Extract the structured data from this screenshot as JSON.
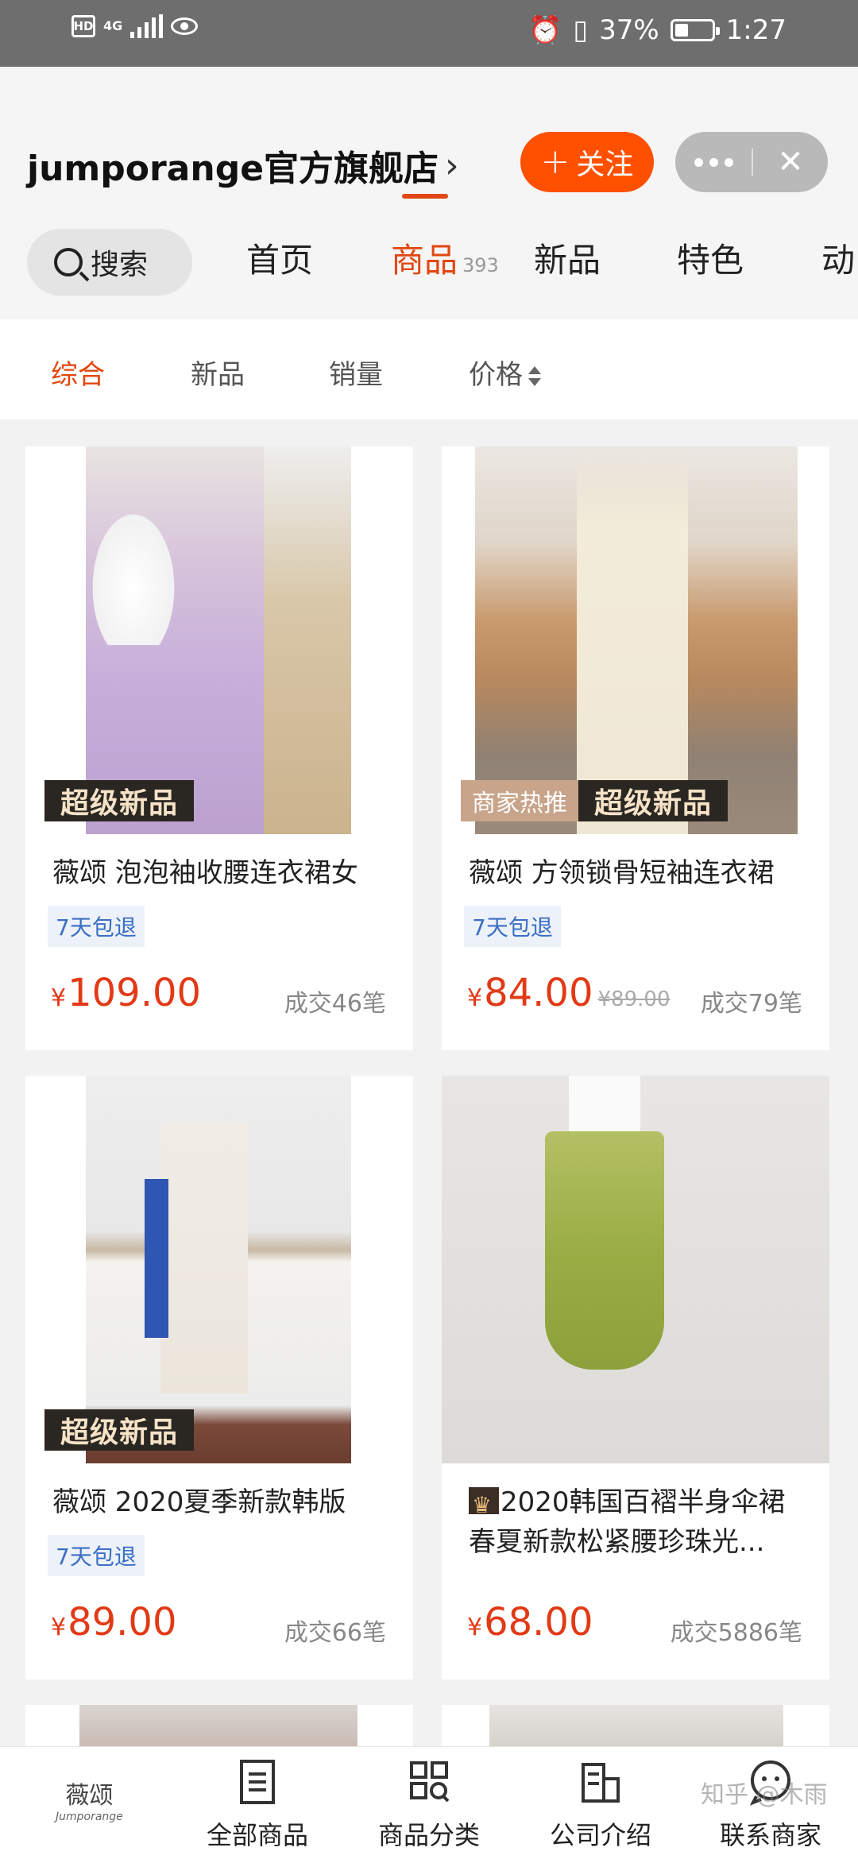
{
  "status_bar": {
    "network": "4G",
    "battery": "37%",
    "time": "1:27"
  },
  "header": {
    "store_name": "jumporange官方旗舰店",
    "follow_label": "关注",
    "search_label": "搜索",
    "tabs": [
      {
        "label": "首页"
      },
      {
        "label": "商品",
        "count": "393",
        "active": true
      },
      {
        "label": "新品"
      },
      {
        "label": "特色"
      },
      {
        "label": "动"
      }
    ]
  },
  "sort": {
    "items": [
      "综合",
      "新品",
      "销量",
      "价格"
    ],
    "active": "综合"
  },
  "products": [
    {
      "title": "薇颂 泡泡袖收腰连衣裙女",
      "tag_new": "超级新品",
      "badge": "7天包退",
      "price": "109.00",
      "sales": "成交46笔"
    },
    {
      "title": "薇颂 方领锁骨短袖连衣裙",
      "tag_hot": "商家热推",
      "tag_new": "超级新品",
      "badge": "7天包退",
      "price": "84.00",
      "original_price": "¥89.00",
      "sales": "成交79笔"
    },
    {
      "title": "薇颂  2020夏季新款韩版",
      "tag_new": "超级新品",
      "badge": "7天包退",
      "price": "89.00",
      "sales": "成交66笔"
    },
    {
      "title_line1": "2020韩国百褶半身伞裙",
      "title_line2": "春夏新款松紧腰珍珠光...",
      "price": "68.00",
      "sales": "成交5886笔"
    }
  ],
  "currency": "¥",
  "bottom_nav": {
    "logo_main": "薇颂",
    "logo_sub": "Jumporange",
    "items": [
      "全部商品",
      "商品分类",
      "公司介绍",
      "联系商家"
    ]
  },
  "watermark": "知乎 @木雨",
  "colors": {
    "accent": "#ff5000",
    "price": "#e23a16",
    "tab_active": "#e2470f",
    "badge_text": "#3b6fc4"
  }
}
